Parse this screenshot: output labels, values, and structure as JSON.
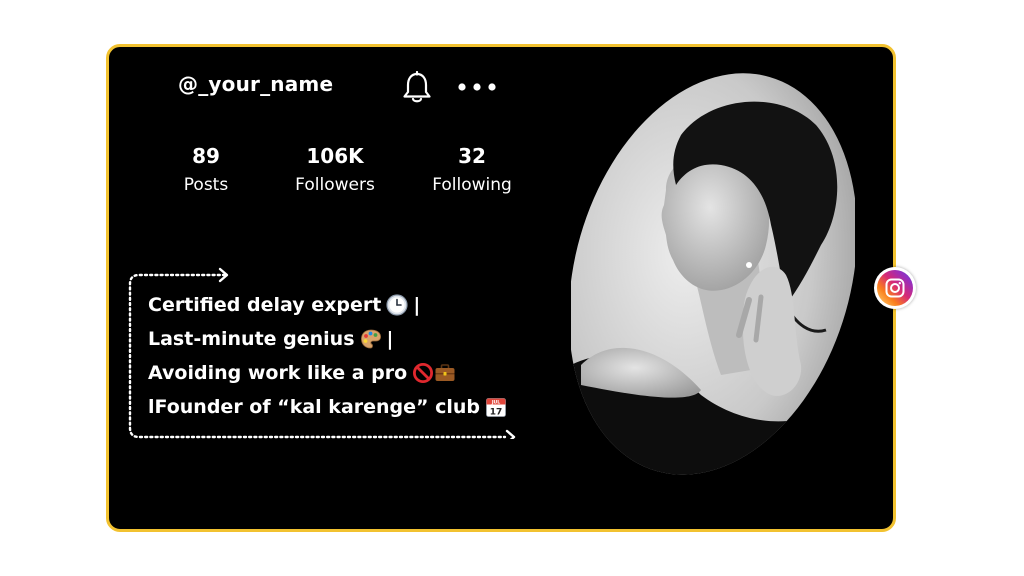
{
  "profile": {
    "username": "@_your_name"
  },
  "stats": [
    {
      "value": "89",
      "label": "Posts"
    },
    {
      "value": "106K",
      "label": "Followers"
    },
    {
      "value": "32",
      "label": "Following"
    }
  ],
  "bio": {
    "lines": [
      {
        "text": "Certified delay expert",
        "suffix": "|"
      },
      {
        "text": "Last-minute genius",
        "suffix": "|"
      },
      {
        "text": "Avoiding work like a pro",
        "suffix": ""
      },
      {
        "text": "lFounder of “kal karenge” club",
        "suffix": ""
      }
    ],
    "calendar_month": "JUL",
    "calendar_day": "17"
  },
  "icons": {
    "notifications": "bell-icon",
    "more": "more-dots-icon",
    "instagram": "instagram-icon"
  },
  "colors": {
    "card_background": "#000000",
    "card_border": "#f2c230",
    "text": "#ffffff"
  }
}
